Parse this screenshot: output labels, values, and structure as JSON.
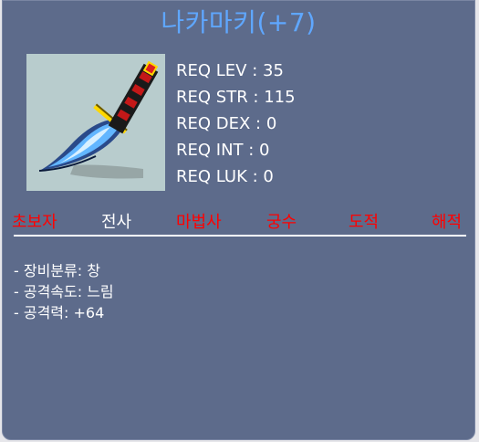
{
  "item": {
    "name": "나카마키(+7)",
    "icon": "knife-icon",
    "requirements": [
      {
        "label": "REQ LEV : 35"
      },
      {
        "label": "REQ STR : 115"
      },
      {
        "label": "REQ DEX : 0"
      },
      {
        "label": "REQ INT : 0"
      },
      {
        "label": "REQ LUK : 0"
      }
    ],
    "jobs": [
      {
        "label": "초보자",
        "allowed": false
      },
      {
        "label": "전사",
        "allowed": true
      },
      {
        "label": "마법사",
        "allowed": false
      },
      {
        "label": "궁수",
        "allowed": false
      },
      {
        "label": "도적",
        "allowed": false
      },
      {
        "label": "해적",
        "allowed": false
      }
    ],
    "stats": [
      "- 장비분류: 창",
      "- 공격속도: 느림",
      "- 공격력: +64"
    ]
  },
  "colors": {
    "panel": "#5d6b8b",
    "title": "#5fa7ff",
    "allowed_job": "#ffffff",
    "restricted_job": "#ff0000"
  }
}
